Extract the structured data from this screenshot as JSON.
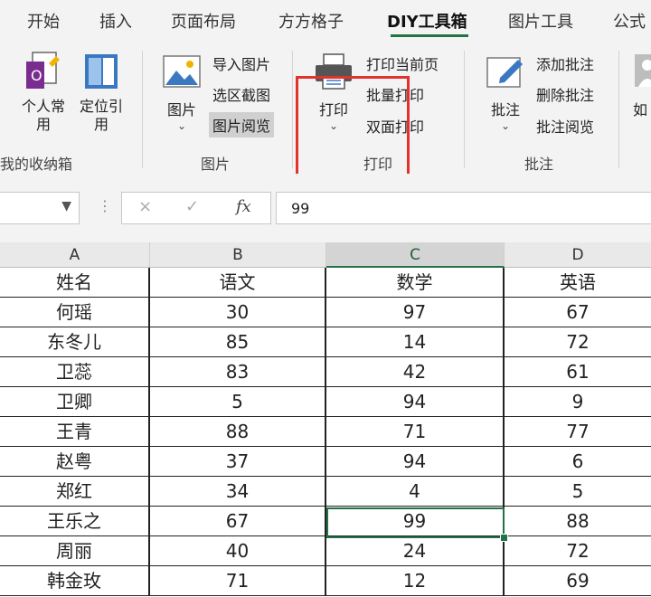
{
  "tabs": [
    "开始",
    "插入",
    "页面布局",
    "方方格子",
    "DIY工具箱",
    "图片工具",
    "公式"
  ],
  "active_tab": "DIY工具箱",
  "ribbon": {
    "groups": {
      "mycollection": {
        "label": "我的收纳箱",
        "btn_personal": "个人常\n用",
        "btn_locate": "定位引\n用"
      },
      "picture": {
        "label": "图片",
        "btn_picture": "图片",
        "import_picture": "导入图片",
        "region_screenshot": "选区截图",
        "picture_viewer": "图片阅览"
      },
      "print": {
        "label": "打印",
        "btn_print": "打印",
        "print_current_page": "打印当前页",
        "batch_print": "批量打印",
        "duplex_print": "双面打印"
      },
      "comment": {
        "label": "批注",
        "btn_comment": "批注",
        "add_comment": "添加批注",
        "delete_comment": "删除批注",
        "comment_viewer": "批注阅览"
      },
      "cut": {
        "btn_label": "如"
      }
    }
  },
  "formula_bar": {
    "cancel_icon": "×",
    "enter_icon": "✓",
    "fx_label": "fx",
    "value": "99"
  },
  "columns": [
    "A",
    "B",
    "C",
    "D"
  ],
  "selected_column": "C",
  "table": {
    "headers": [
      "姓名",
      "语文",
      "数学",
      "英语"
    ],
    "rows": [
      [
        "何瑶",
        "30",
        "97",
        "67"
      ],
      [
        "东冬儿",
        "85",
        "14",
        "72"
      ],
      [
        "卫蕊",
        "83",
        "42",
        "61"
      ],
      [
        "卫卿",
        "5",
        "94",
        "9"
      ],
      [
        "王青",
        "88",
        "71",
        "77"
      ],
      [
        "赵粤",
        "37",
        "94",
        "6"
      ],
      [
        "郑红",
        "34",
        "4",
        "5"
      ],
      [
        "王乐之",
        "67",
        "99",
        "88"
      ],
      [
        "周丽",
        "40",
        "24",
        "72"
      ],
      [
        "韩金玫",
        "71",
        "12",
        "69"
      ]
    ]
  },
  "colors": {
    "accent": "#217346",
    "highlight": "#e3322b"
  }
}
